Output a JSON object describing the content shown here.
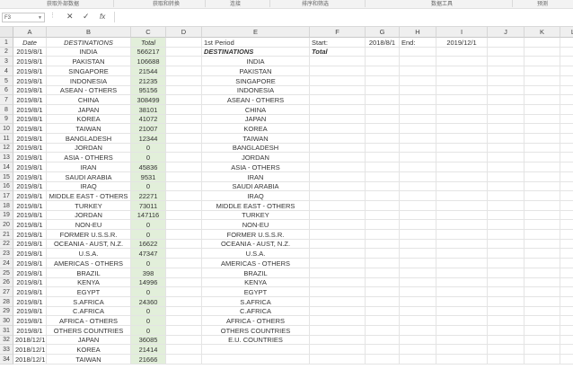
{
  "ribbon": {
    "groups": [
      "获取外部数据",
      "获取和转换",
      "连接",
      "排序和筛选",
      "数据工具",
      "预测"
    ]
  },
  "formula_bar": {
    "name_box": "F3",
    "cancel_icon": "✕",
    "enter_icon": "✓",
    "fx_label": "fx",
    "value": ""
  },
  "columns": [
    "A",
    "B",
    "C",
    "D",
    "E",
    "F",
    "G",
    "H",
    "I",
    "J",
    "K",
    "L"
  ],
  "rows": [
    [
      "Date",
      "DESTINATIONS",
      "Total",
      "",
      "1st Period",
      "Start:",
      "2018/8/1",
      "End:",
      "2019/12/1",
      "",
      "",
      ""
    ],
    [
      "2019/8/1",
      "INDIA",
      "566217",
      "",
      "DESTINATIONS",
      "Total",
      "",
      "",
      "",
      "",
      "",
      ""
    ],
    [
      "2019/8/1",
      "PAKISTAN",
      "106688",
      "",
      "INDIA",
      "",
      "",
      "",
      "",
      "",
      "",
      ""
    ],
    [
      "2019/8/1",
      "SINGAPORE",
      "21544",
      "",
      "PAKISTAN",
      "",
      "",
      "",
      "",
      "",
      "",
      ""
    ],
    [
      "2019/8/1",
      "INDONESIA",
      "21235",
      "",
      "SINGAPORE",
      "",
      "",
      "",
      "",
      "",
      "",
      ""
    ],
    [
      "2019/8/1",
      "ASEAN - OTHERS",
      "95156",
      "",
      "INDONESIA",
      "",
      "",
      "",
      "",
      "",
      "",
      ""
    ],
    [
      "2019/8/1",
      "CHINA",
      "308499",
      "",
      "ASEAN - OTHERS",
      "",
      "",
      "",
      "",
      "",
      "",
      ""
    ],
    [
      "2019/8/1",
      "JAPAN",
      "38101",
      "",
      "CHINA",
      "",
      "",
      "",
      "",
      "",
      "",
      ""
    ],
    [
      "2019/8/1",
      "KOREA",
      "41072",
      "",
      "JAPAN",
      "",
      "",
      "",
      "",
      "",
      "",
      ""
    ],
    [
      "2019/8/1",
      "TAIWAN",
      "21007",
      "",
      "KOREA",
      "",
      "",
      "",
      "",
      "",
      "",
      ""
    ],
    [
      "2019/8/1",
      "BANGLADESH",
      "12344",
      "",
      "TAIWAN",
      "",
      "",
      "",
      "",
      "",
      "",
      ""
    ],
    [
      "2019/8/1",
      "JORDAN",
      "0",
      "",
      "BANGLADESH",
      "",
      "",
      "",
      "",
      "",
      "",
      ""
    ],
    [
      "2019/8/1",
      "ASIA - OTHERS",
      "0",
      "",
      "JORDAN",
      "",
      "",
      "",
      "",
      "",
      "",
      ""
    ],
    [
      "2019/8/1",
      "IRAN",
      "45836",
      "",
      "ASIA - OTHERS",
      "",
      "",
      "",
      "",
      "",
      "",
      ""
    ],
    [
      "2019/8/1",
      "SAUDI ARABIA",
      "9531",
      "",
      "IRAN",
      "",
      "",
      "",
      "",
      "",
      "",
      ""
    ],
    [
      "2019/8/1",
      "IRAQ",
      "0",
      "",
      "SAUDI ARABIA",
      "",
      "",
      "",
      "",
      "",
      "",
      ""
    ],
    [
      "2019/8/1",
      "MIDDLE EAST - OTHERS",
      "22271",
      "",
      "IRAQ",
      "",
      "",
      "",
      "",
      "",
      "",
      ""
    ],
    [
      "2019/8/1",
      "TURKEY",
      "73011",
      "",
      "MIDDLE EAST - OTHERS",
      "",
      "",
      "",
      "",
      "",
      "",
      ""
    ],
    [
      "2019/8/1",
      "JORDAN",
      "147116",
      "",
      "TURKEY",
      "",
      "",
      "",
      "",
      "",
      "",
      ""
    ],
    [
      "2019/8/1",
      "NON-EU",
      "0",
      "",
      "NON-EU",
      "",
      "",
      "",
      "",
      "",
      "",
      ""
    ],
    [
      "2019/8/1",
      "FORMER U.S.S.R.",
      "0",
      "",
      "FORMER U.S.S.R.",
      "",
      "",
      "",
      "",
      "",
      "",
      ""
    ],
    [
      "2019/8/1",
      "OCEANIA - AUST, N.Z.",
      "16622",
      "",
      "OCEANIA - AUST, N.Z.",
      "",
      "",
      "",
      "",
      "",
      "",
      ""
    ],
    [
      "2019/8/1",
      "U.S.A.",
      "47347",
      "",
      "U.S.A.",
      "",
      "",
      "",
      "",
      "",
      "",
      ""
    ],
    [
      "2019/8/1",
      "AMERICAS - OTHERS",
      "0",
      "",
      "AMERICAS - OTHERS",
      "",
      "",
      "",
      "",
      "",
      "",
      ""
    ],
    [
      "2019/8/1",
      "BRAZIL",
      "398",
      "",
      "BRAZIL",
      "",
      "",
      "",
      "",
      "",
      "",
      ""
    ],
    [
      "2019/8/1",
      "KENYA",
      "14996",
      "",
      "KENYA",
      "",
      "",
      "",
      "",
      "",
      "",
      ""
    ],
    [
      "2019/8/1",
      "EGYPT",
      "0",
      "",
      "EGYPT",
      "",
      "",
      "",
      "",
      "",
      "",
      ""
    ],
    [
      "2019/8/1",
      "S.AFRICA",
      "24360",
      "",
      "S.AFRICA",
      "",
      "",
      "",
      "",
      "",
      "",
      ""
    ],
    [
      "2019/8/1",
      "C.AFRICA",
      "0",
      "",
      "C.AFRICA",
      "",
      "",
      "",
      "",
      "",
      "",
      ""
    ],
    [
      "2019/8/1",
      "AFRICA - OTHERS",
      "0",
      "",
      "AFRICA - OTHERS",
      "",
      "",
      "",
      "",
      "",
      "",
      ""
    ],
    [
      "2019/8/1",
      "OTHERS COUNTRIES",
      "0",
      "",
      "OTHERS COUNTRIES",
      "",
      "",
      "",
      "",
      "",
      "",
      ""
    ],
    [
      "2018/12/1",
      "JAPAN",
      "36085",
      "",
      "E.U. COUNTRIES",
      "",
      "",
      "",
      "",
      "",
      "",
      ""
    ],
    [
      "2018/12/1",
      "KOREA",
      "21414",
      "",
      "",
      "",
      "",
      "",
      "",
      "",
      "",
      ""
    ],
    [
      "2018/12/1",
      "TAIWAN",
      "21666",
      "",
      "",
      "",
      "",
      "",
      "",
      "",
      "",
      ""
    ]
  ],
  "colors": {
    "total_column": "#e2efda",
    "header_bg": "#efefef"
  }
}
